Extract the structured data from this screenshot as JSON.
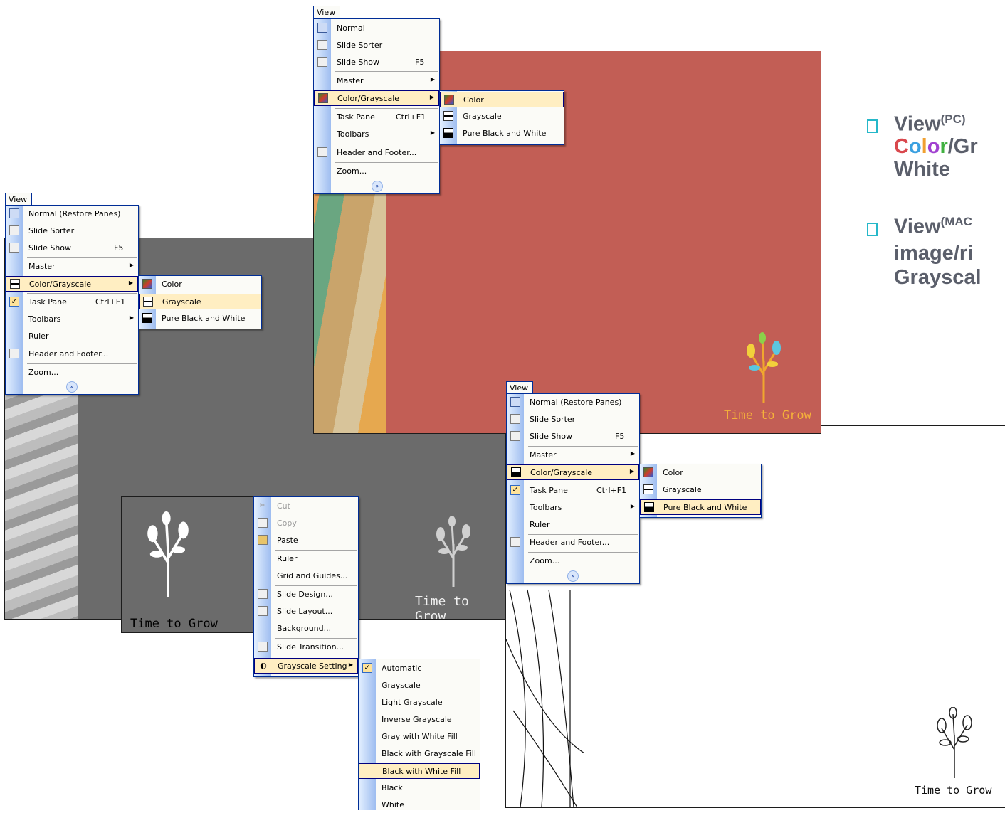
{
  "brand_text": "Time to Grow",
  "colors": {
    "red_bg": "#c25e55",
    "gray_bg": "#6b6b6b",
    "menu_border": "#002d96",
    "highlight": "#ffeec2",
    "accent": "#26b8c9"
  },
  "bullets": [
    {
      "word": "View",
      "sup": "(PC)",
      "rest_color_letters": [
        "C",
        "o",
        "l",
        "o",
        "r"
      ],
      "rest_tail": "/Gr",
      "line2": "White"
    },
    {
      "word": "View",
      "sup": "(MAC",
      "line2": "image/ri",
      "line3": "Grayscal"
    }
  ],
  "menu_top": {
    "tab": "View",
    "items": [
      {
        "label": "Normal",
        "icon": "normal-view-icon"
      },
      {
        "label": "Slide Sorter",
        "icon": "slide-sorter-icon"
      },
      {
        "label": "Slide Show",
        "shortcut": "F5",
        "icon": "slide-show-icon"
      },
      {
        "label": "Master",
        "submenu": true
      },
      {
        "label": "Color/Grayscale",
        "submenu": true,
        "icon": "color-icon"
      },
      {
        "label": "Task Pane",
        "shortcut": "Ctrl+F1"
      },
      {
        "label": "Toolbars",
        "submenu": true
      },
      {
        "label": "Header and Footer...",
        "icon": "header-footer-icon"
      },
      {
        "label": "Zoom..."
      }
    ],
    "submenu": [
      "Color",
      "Grayscale",
      "Pure Black and White"
    ]
  },
  "menu_left": {
    "tab": "View",
    "items": [
      {
        "label": "Normal (Restore Panes)"
      },
      {
        "label": "Slide Sorter"
      },
      {
        "label": "Slide Show",
        "shortcut": "F5"
      },
      {
        "label": "Master"
      },
      {
        "label": "Color/Grayscale"
      },
      {
        "label": "Task Pane",
        "shortcut": "Ctrl+F1"
      },
      {
        "label": "Toolbars"
      },
      {
        "label": "Ruler"
      },
      {
        "label": "Header and Footer..."
      },
      {
        "label": "Zoom..."
      }
    ],
    "submenu": [
      "Color",
      "Grayscale",
      "Pure Black and White"
    ]
  },
  "menu_right": {
    "tab": "View",
    "items": [
      {
        "label": "Normal (Restore Panes)"
      },
      {
        "label": "Slide Sorter"
      },
      {
        "label": "Slide Show",
        "shortcut": "F5"
      },
      {
        "label": "Master"
      },
      {
        "label": "Color/Grayscale"
      },
      {
        "label": "Task Pane",
        "shortcut": "Ctrl+F1"
      },
      {
        "label": "Toolbars"
      },
      {
        "label": "Ruler"
      },
      {
        "label": "Header and Footer..."
      },
      {
        "label": "Zoom..."
      }
    ],
    "submenu": [
      "Color",
      "Grayscale",
      "Pure Black and White"
    ]
  },
  "context_menu": {
    "items": [
      "Cut",
      "Copy",
      "Paste",
      "Ruler",
      "Grid and Guides...",
      "Slide Design...",
      "Slide Layout...",
      "Background...",
      "Slide Transition...",
      "Grayscale Setting"
    ],
    "submenu": [
      "Automatic",
      "Grayscale",
      "Light Grayscale",
      "Inverse Grayscale",
      "Gray with White Fill",
      "Black with Grayscale Fill",
      "Black with White Fill",
      "Black",
      "White"
    ]
  }
}
